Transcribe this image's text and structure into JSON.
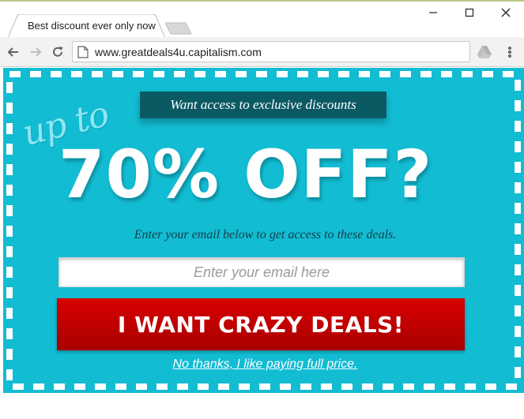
{
  "browser": {
    "tab_title": "Best discount ever only now",
    "url": "www.greatdeals4u.capitalism.com",
    "icons": {
      "back": "back-arrow-icon",
      "forward": "forward-arrow-icon",
      "reload": "reload-icon",
      "page": "page-icon",
      "extension": "drive-extension-icon",
      "menu": "kebab-menu-icon",
      "minimize": "minimize-icon",
      "maximize": "maximize-icon",
      "close": "close-icon"
    }
  },
  "offer": {
    "banner": "Want access to exclusive discounts",
    "upto": "up to",
    "headline": "70% OFF?",
    "subtext": "Enter your email below to get access to these deals.",
    "email_placeholder": "Enter your email here",
    "cta_label": "I WANT CRAZY DEALS!",
    "decline_label": "No thanks, I like paying full price."
  },
  "colors": {
    "background": "#12bcd3",
    "banner": "#0b5a63",
    "cta": "#c40000",
    "dash_border": "#ffffff"
  }
}
